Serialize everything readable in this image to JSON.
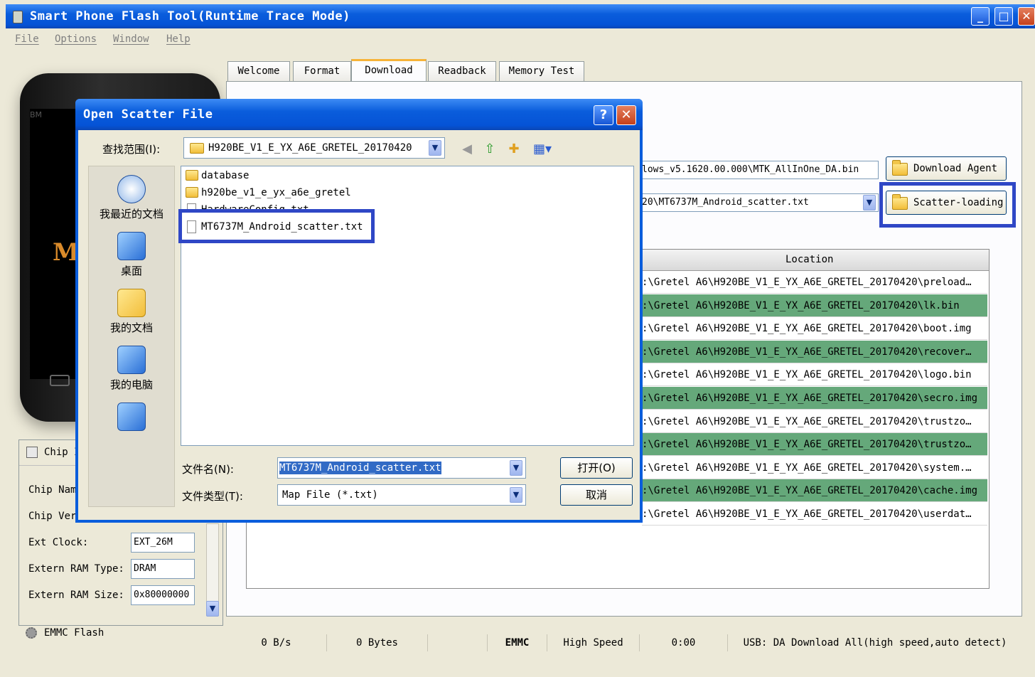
{
  "window": {
    "title": "Smart Phone Flash Tool(Runtime Trace Mode)",
    "min_glyph": "_",
    "max_glyph": "□",
    "close_glyph": "✕"
  },
  "menu": [
    "File",
    "Options",
    "Window",
    "Help"
  ],
  "tabs": [
    "Welcome",
    "Format",
    "Download",
    "Readback",
    "Memory Test"
  ],
  "active_tab": "Download",
  "phone": {
    "brand_partial": "BM",
    "logo_partial": "M"
  },
  "download": {
    "agent_path": "lows_v5.1620.00.000\\MTK_AllInOne_DA.bin",
    "agent_button": "Download Agent",
    "scatter_path": "20\\MT6737M_Android_scatter.txt",
    "scatter_button": "Scatter-loading",
    "dropdown_glyph": "▼"
  },
  "location_table": {
    "header": "Location",
    "rows": [
      {
        "text": ":\\Gretel A6\\H920BE_V1_E_YX_A6E_GRETEL_20170420\\preload…",
        "highlighted": false
      },
      {
        "text": ":\\Gretel A6\\H920BE_V1_E_YX_A6E_GRETEL_20170420\\lk.bin",
        "highlighted": true
      },
      {
        "text": ":\\Gretel A6\\H920BE_V1_E_YX_A6E_GRETEL_20170420\\boot.img",
        "highlighted": false
      },
      {
        "text": ":\\Gretel A6\\H920BE_V1_E_YX_A6E_GRETEL_20170420\\recover…",
        "highlighted": true
      },
      {
        "text": ":\\Gretel A6\\H920BE_V1_E_YX_A6E_GRETEL_20170420\\logo.bin",
        "highlighted": false
      },
      {
        "text": ":\\Gretel A6\\H920BE_V1_E_YX_A6E_GRETEL_20170420\\secro.img",
        "highlighted": true
      },
      {
        "text": ":\\Gretel A6\\H920BE_V1_E_YX_A6E_GRETEL_20170420\\trustzo…",
        "highlighted": false
      },
      {
        "text": ":\\Gretel A6\\H920BE_V1_E_YX_A6E_GRETEL_20170420\\trustzo…",
        "highlighted": true
      },
      {
        "text": ":\\Gretel A6\\H920BE_V1_E_YX_A6E_GRETEL_20170420\\system.…",
        "highlighted": false
      },
      {
        "text": ":\\Gretel A6\\H920BE_V1_E_YX_A6E_GRETEL_20170420\\cache.img",
        "highlighted": true
      },
      {
        "text": ":\\Gretel A6\\H920BE_V1_E_YX_A6E_GRETEL_20170420\\userdat…",
        "highlighted": false
      }
    ]
  },
  "chip_panel": {
    "title": "Chip I",
    "chip_name_label": "Chip Nam",
    "chip_ver_label": "Chip Ver",
    "ext_clock_label": "Ext Clock:",
    "ext_clock_value": "EXT_26M",
    "ram_type_label": "Extern RAM Type:",
    "ram_type_value": "DRAM",
    "ram_size_label": "Extern RAM Size:",
    "ram_size_value": "0x80000000",
    "scroll_down_glyph": "▼"
  },
  "emmc": {
    "label": "EMMC Flash"
  },
  "status_bar": {
    "speed": "0 B/s",
    "bytes": "0 Bytes",
    "storage": "EMMC",
    "mode": "High Speed",
    "time": "0:00",
    "usb": "USB: DA Download All(high speed,auto detect)"
  },
  "dialog": {
    "title": "Open Scatter File",
    "help_glyph": "?",
    "close_glyph": "✕",
    "look_in_label": "查找范围(I):",
    "look_in_value": "H920BE_V1_E_YX_A6E_GRETEL_20170420",
    "combo_arrow": "▼",
    "toolbar": {
      "back": "◀",
      "up": "⇧",
      "new_folder": "✚",
      "views": "▦▾"
    },
    "places": [
      "我最近的文档",
      "桌面",
      "我的文档",
      "我的电脑",
      ""
    ],
    "files": [
      {
        "name": "database",
        "type": "folder"
      },
      {
        "name": "h920be_v1_e_yx_a6e_gretel",
        "type": "folder"
      },
      {
        "name": "HardwareConfig.txt",
        "type": "file"
      },
      {
        "name": "MT6737M_Android_scatter.txt",
        "type": "file",
        "selected": true
      }
    ],
    "filename_label": "文件名(N):",
    "filename_value": "MT6737M_Android_scatter.txt",
    "filetype_label": "文件类型(T):",
    "filetype_value": "Map File (*.txt)",
    "open_button": "打开(O)",
    "cancel_button": "取消"
  },
  "colors": {
    "highlight_box": "#2f47c6",
    "green_row": "#65a87a",
    "xp_blue": "#0a5ddc"
  }
}
